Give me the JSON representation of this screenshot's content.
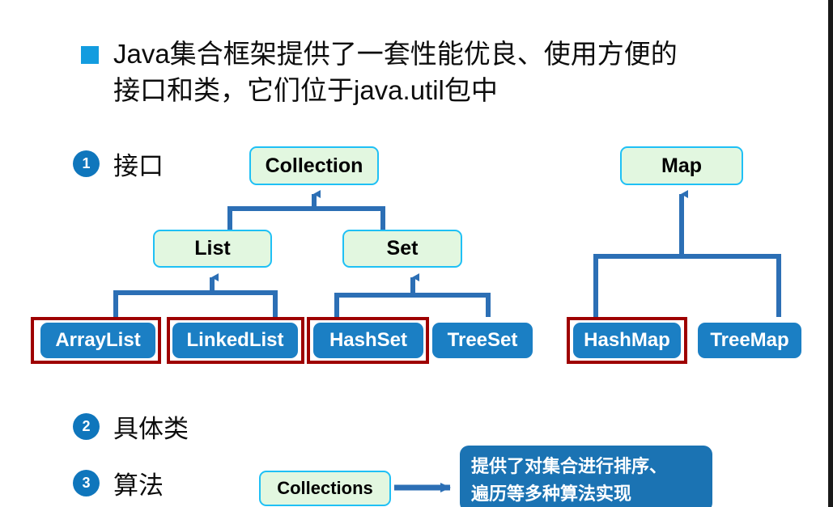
{
  "slide": {
    "heading": {
      "bullet_icon": "square-bullet-icon",
      "text": "Java集合框架提供了一套性能优良、使用方便的\n接口和类，它们位于java.util包中"
    },
    "numbered_items": [
      {
        "number": "1",
        "label": "接口"
      },
      {
        "number": "2",
        "label": "具体类"
      },
      {
        "number": "3",
        "label": "算法"
      }
    ],
    "diagram": {
      "interfaces": [
        {
          "id": "collection",
          "label": "Collection"
        },
        {
          "id": "list",
          "label": "List"
        },
        {
          "id": "set",
          "label": "Set"
        },
        {
          "id": "map",
          "label": "Map"
        }
      ],
      "classes": [
        {
          "id": "arraylist",
          "label": "ArrayList",
          "highlighted": "true"
        },
        {
          "id": "linkedlist",
          "label": "LinkedList",
          "highlighted": "true"
        },
        {
          "id": "hashset",
          "label": "HashSet",
          "highlighted": "true"
        },
        {
          "id": "treeset",
          "label": "TreeSet",
          "highlighted": "false"
        },
        {
          "id": "hashmap",
          "label": "HashMap",
          "highlighted": "true"
        },
        {
          "id": "treemap",
          "label": "TreeMap",
          "highlighted": "false"
        }
      ]
    },
    "algorithm_section": {
      "collections_box_label": "Collections",
      "callout_text": "提供了对集合进行排序、\n遍历等多种算法实现"
    },
    "colors": {
      "bullet_square": "#139CDF",
      "badge_blue": "#0F76BC",
      "interface_fill": "#E2F7E0",
      "interface_border": "#1FC0F5",
      "class_fill": "#1B7FC4",
      "highlight_red": "#9E0000",
      "connector_blue": "#2C6FB5",
      "callout_fill": "#1B73B3",
      "edge_border": "#1A1A1A"
    }
  }
}
